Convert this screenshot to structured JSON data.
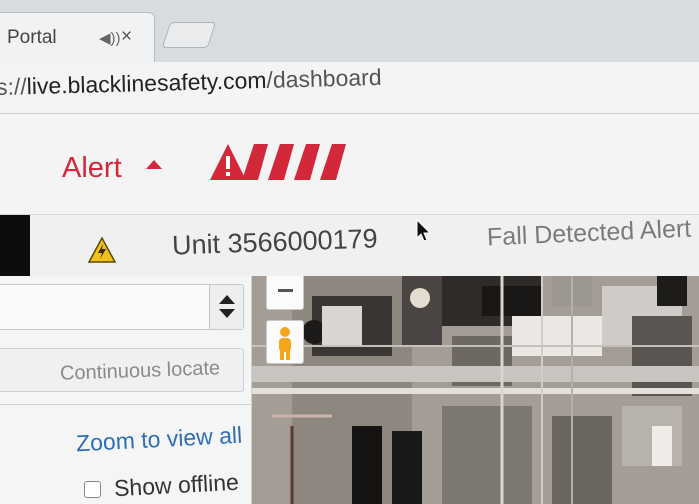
{
  "browser": {
    "tab_title": "Portal",
    "url_prefix": "s://",
    "url_host": "live.blacklinesafety.com",
    "url_path": "/dashboard"
  },
  "alert_header": {
    "label": "Alert",
    "level_bars": 4,
    "color": "#d3283a"
  },
  "unit_row": {
    "unit_label": "Unit 3566000179",
    "alert_type": "Fall Detected Alert"
  },
  "left_panel": {
    "locate_label": "Continuous locate",
    "zoom_link": "Zoom to view all",
    "offline_label": "Show offline",
    "offline_checked": false
  },
  "icons": [
    "speaker-icon",
    "close-icon",
    "warning-triangle-icon",
    "cursor-icon",
    "zoom-out-icon",
    "pegman-icon",
    "select-arrows-icon"
  ]
}
